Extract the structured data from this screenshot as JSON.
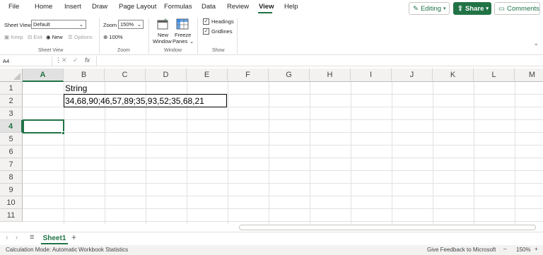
{
  "menu": {
    "items": [
      "File",
      "Home",
      "Insert",
      "Draw",
      "Page Layout",
      "Formulas",
      "Data",
      "Review",
      "View",
      "Help"
    ],
    "active": "View",
    "editing_label": "Editing",
    "share_label": "Share",
    "comments_label": "Comments"
  },
  "ribbon": {
    "sheet_view": {
      "label": "Sheet View",
      "selected": "Default",
      "keep": "Keep",
      "exit": "Exit",
      "new": "New",
      "options": "Options",
      "group_label": "Sheet View"
    },
    "zoom": {
      "label": "Zoom",
      "value": "150%",
      "hundred": "100%",
      "group_label": "Zoom"
    },
    "window": {
      "new_window_1": "New",
      "new_window_2": "Window",
      "freeze_1": "Freeze",
      "freeze_2": "Panes",
      "group_label": "Window"
    },
    "show": {
      "headings": "Headings",
      "gridlines": "Gridlines",
      "group_label": "Show"
    }
  },
  "formula_bar": {
    "name_box": "A4",
    "fx": "fx",
    "value": ""
  },
  "grid": {
    "columns": [
      "A",
      "B",
      "C",
      "D",
      "E",
      "F",
      "G",
      "H",
      "I",
      "J",
      "K",
      "L",
      "M"
    ],
    "rows": [
      "1",
      "2",
      "3",
      "4",
      "5",
      "6",
      "7",
      "8",
      "9",
      "10",
      "11"
    ],
    "selected_column": "A",
    "selected_row": "4",
    "cells": {
      "B1": "String",
      "B2": "34,68,90;46,57,89;35,93,52;35,68,21"
    }
  },
  "sheets": {
    "tabs": [
      "Sheet1"
    ],
    "active": "Sheet1"
  },
  "status": {
    "calc_mode": "Calculation Mode: Automatic",
    "workbook_stats": "Workbook Statistics",
    "feedback": "Give Feedback to Microsoft",
    "zoom": "150%",
    "minus": "–",
    "plus": "+"
  },
  "colors": {
    "accent": "#217346"
  }
}
